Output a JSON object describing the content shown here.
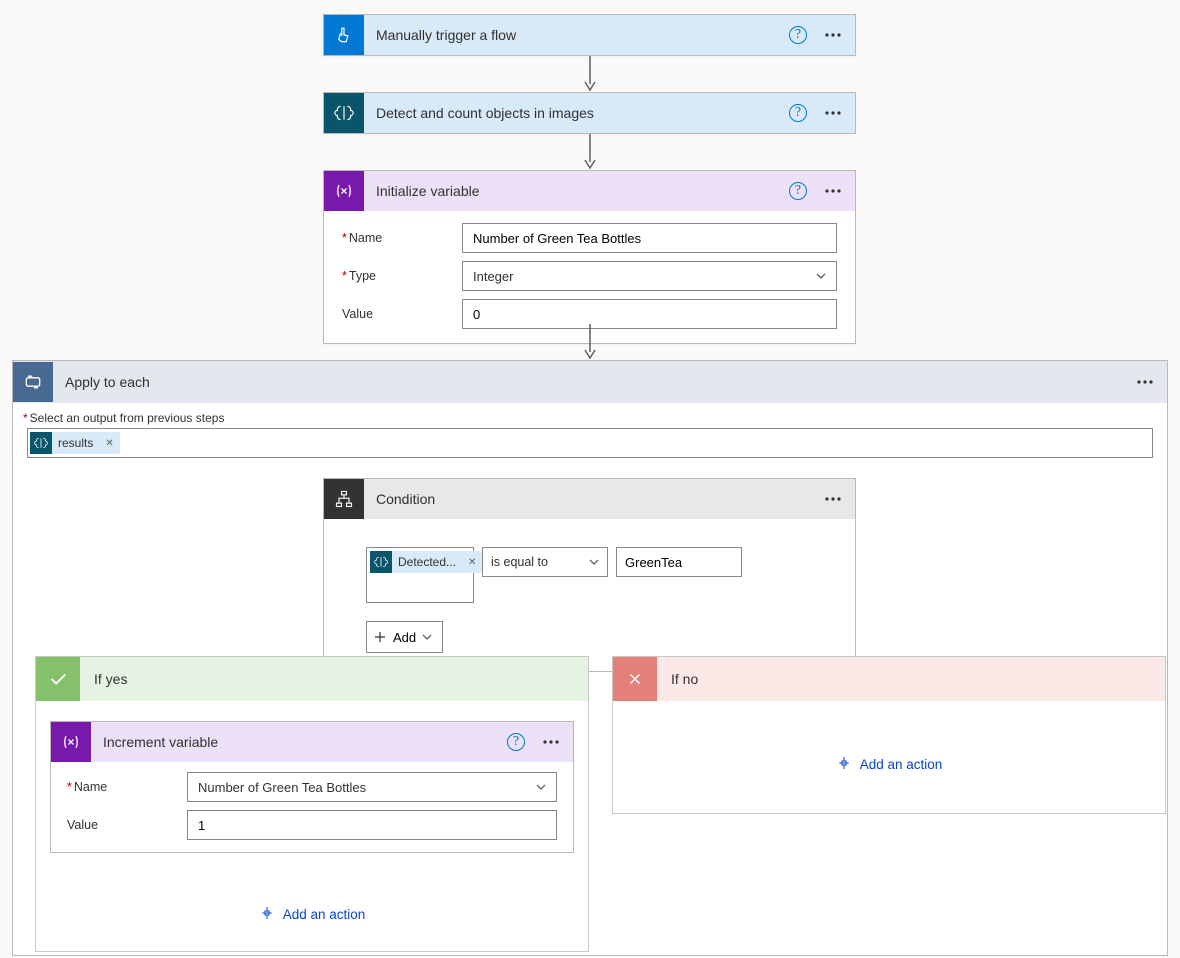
{
  "trigger": {
    "title": "Manually trigger a flow"
  },
  "aibuilder": {
    "title": "Detect and count objects in images"
  },
  "initvar": {
    "title": "Initialize variable",
    "name_label": "Name",
    "name_value": "Number of Green Tea Bottles",
    "type_label": "Type",
    "type_value": "Integer",
    "value_label": "Value",
    "value_value": "0"
  },
  "loop": {
    "title": "Apply to each",
    "select_label": "Select an output from previous steps",
    "token_label": "results"
  },
  "condition": {
    "title": "Condition",
    "token_label": "Detected...",
    "operator": "is equal to",
    "value": "GreenTea",
    "add_label": "Add"
  },
  "branches": {
    "yes_title": "If yes",
    "no_title": "If no",
    "add_action": "Add an action"
  },
  "incvar": {
    "title": "Increment variable",
    "name_label": "Name",
    "name_value": "Number of Green Tea Bottles",
    "value_label": "Value",
    "value_value": "1"
  }
}
